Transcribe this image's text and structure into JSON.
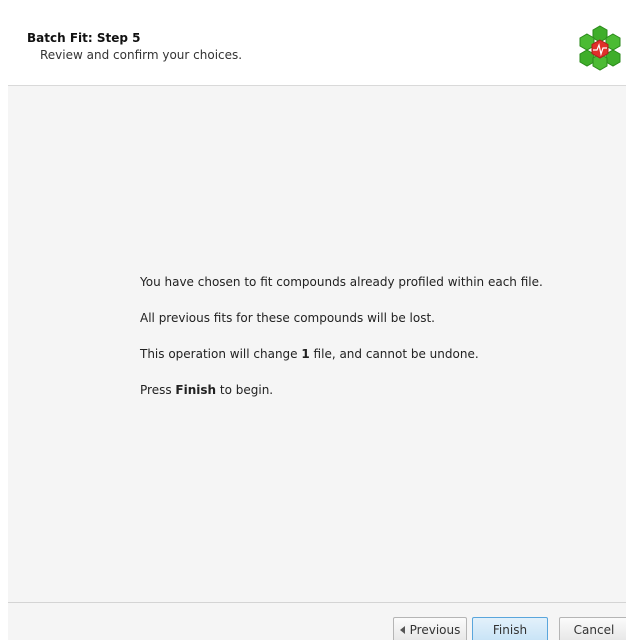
{
  "header": {
    "title": "Batch Fit: Step 5",
    "subtitle": "Review and confirm your choices.",
    "logo_icon": "honeycomb-logo-icon"
  },
  "main": {
    "line1": "You have chosen to fit compounds already profiled within each file.",
    "line2": "All previous fits for these compounds will be lost.",
    "line3_prefix": "This operation will change ",
    "line3_count": "1",
    "line3_suffix": " file, and cannot be undone.",
    "line4_prefix": "Press ",
    "line4_bold": "Finish",
    "line4_suffix": " to begin."
  },
  "footer": {
    "previous_label": "Previous",
    "finish_label": "Finish",
    "cancel_label": "Cancel"
  },
  "colors": {
    "hex_green": "#3fae2a",
    "hex_red": "#e0302a",
    "accent_blue": "#5aa6dc"
  }
}
